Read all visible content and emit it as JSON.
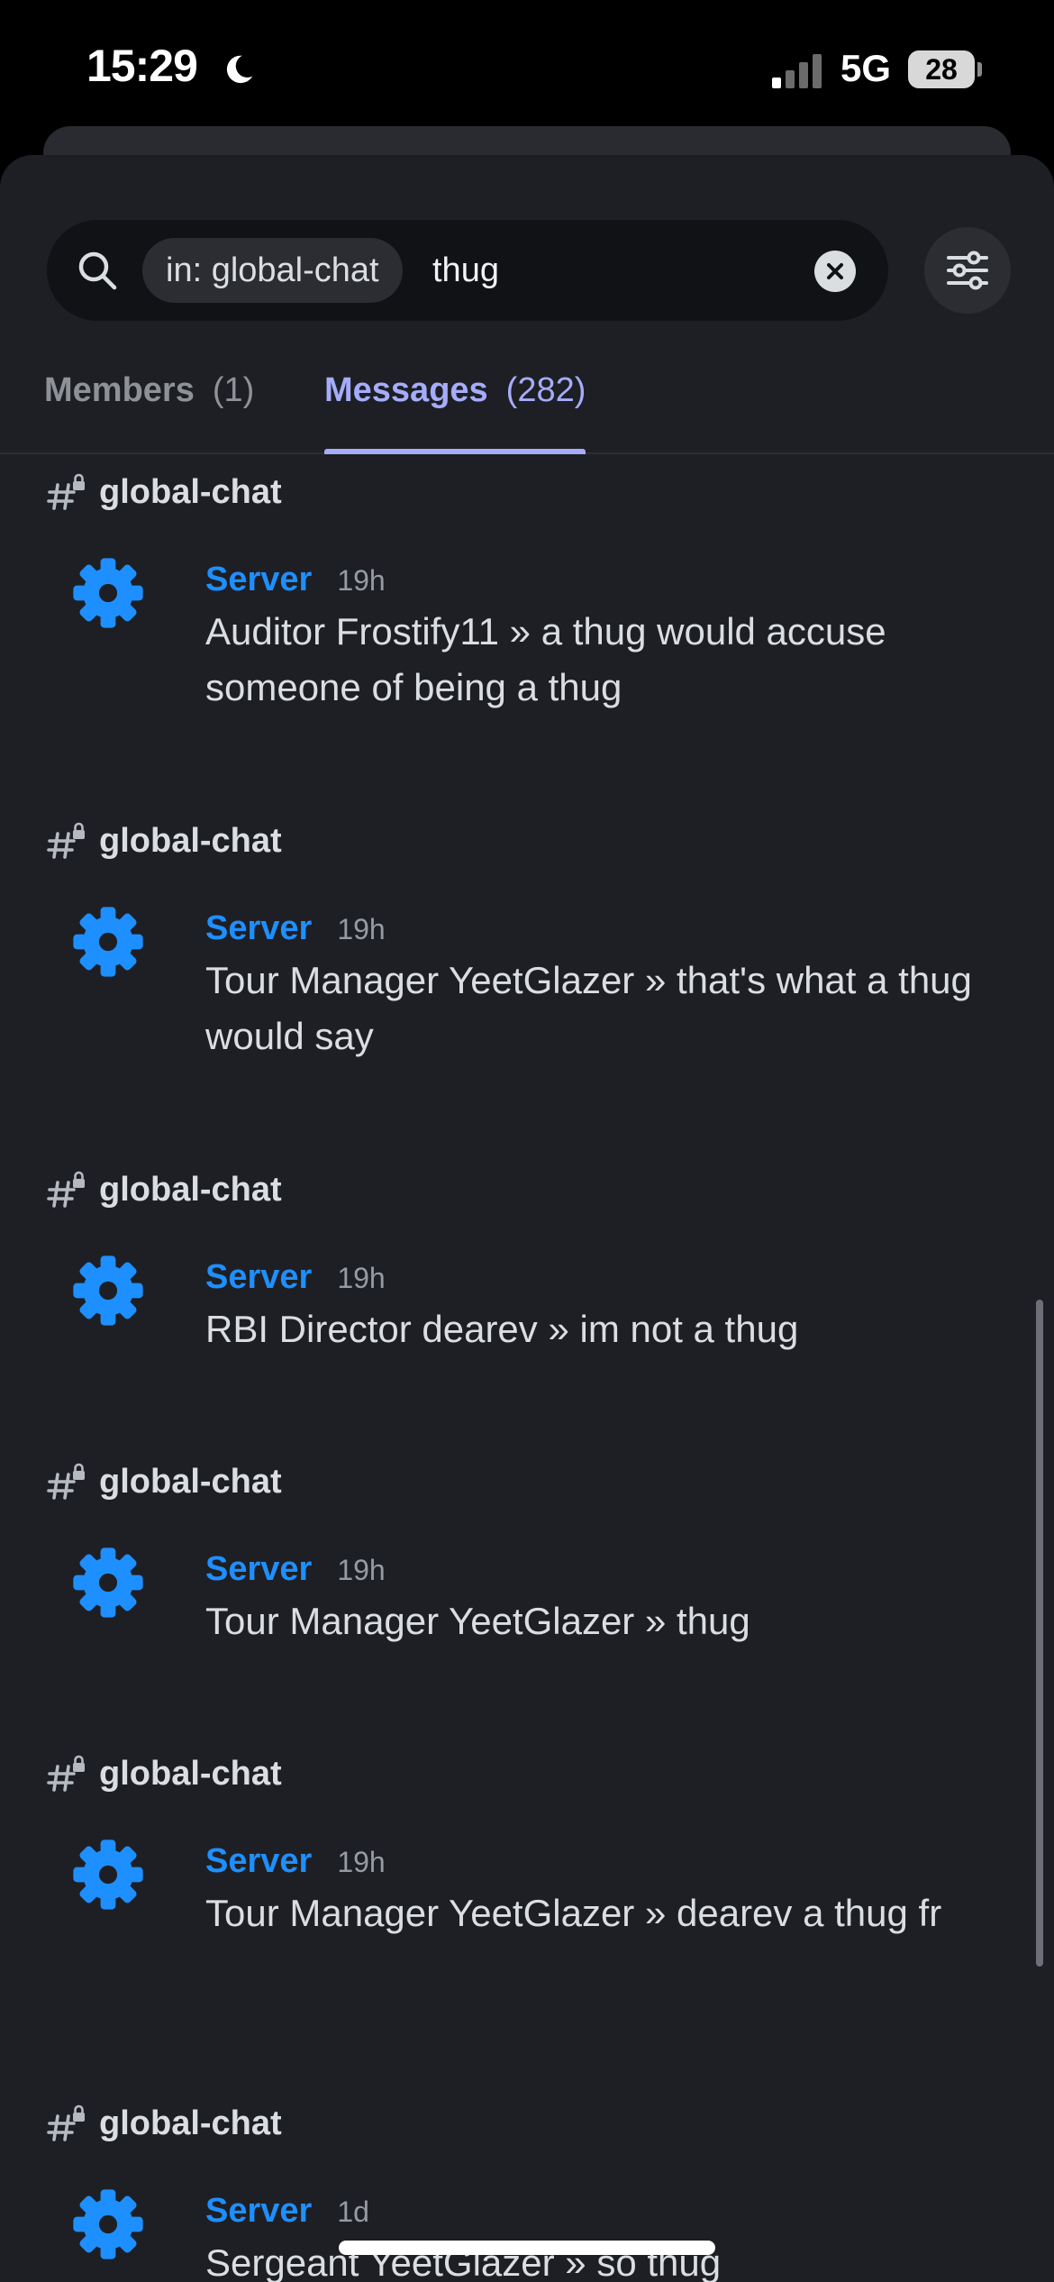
{
  "status_bar": {
    "time": "15:29",
    "network": "5G",
    "battery": "28",
    "icons": [
      "moon-icon",
      "signal-icon",
      "battery-icon"
    ]
  },
  "search": {
    "chip": "in: global-chat",
    "value": "thug",
    "icons": [
      "search-icon",
      "clear-icon",
      "filter-sliders-icon"
    ]
  },
  "tabs": [
    {
      "label": "Members",
      "count": "(1)",
      "active": false
    },
    {
      "label": "Messages",
      "count": "(282)",
      "active": true
    }
  ],
  "results": [
    {
      "channel": "global-chat",
      "author": "Server",
      "time": "19h",
      "text": "Auditor Frostify11 » a thug would accuse someone of being a thug"
    },
    {
      "channel": "global-chat",
      "author": "Server",
      "time": "19h",
      "text": "Tour Manager YeetGlazer » that's what a thug would say"
    },
    {
      "channel": "global-chat",
      "author": "Server",
      "time": "19h",
      "text": "RBI Director dearev » im not a thug"
    },
    {
      "channel": "global-chat",
      "author": "Server",
      "time": "19h",
      "text": "Tour Manager YeetGlazer » thug"
    },
    {
      "channel": "global-chat",
      "author": "Server",
      "time": "19h",
      "text": "Tour Manager YeetGlazer » dearev a thug fr"
    },
    {
      "channel": "global-chat",
      "author": "Server",
      "time": "1d",
      "text": "Sergeant YeetGlazer » so thug"
    }
  ],
  "colors": {
    "accent": "#a5acfb",
    "author": "#1e8fff",
    "gear": "#1e8fff",
    "background": "#1e1f24"
  }
}
